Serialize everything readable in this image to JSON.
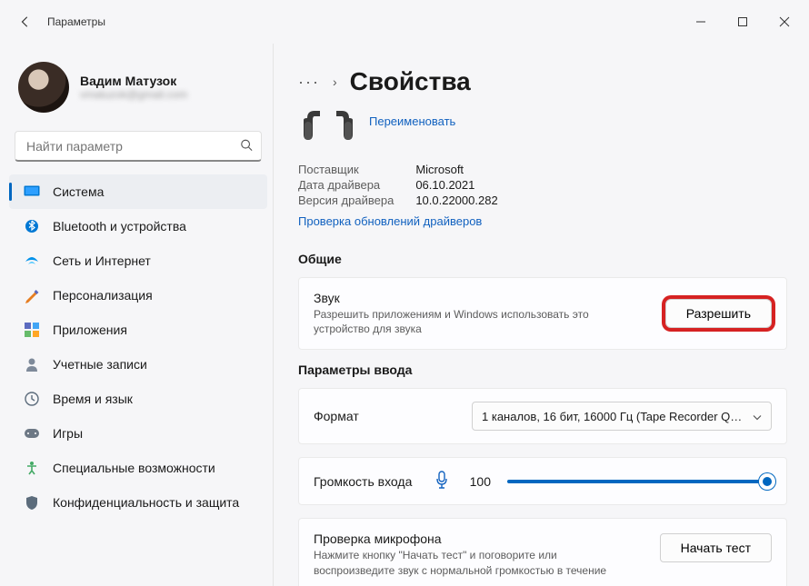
{
  "window": {
    "title": "Параметры"
  },
  "user": {
    "name": "Вадим Матузок",
    "email": "vmatuzok@gmail.com"
  },
  "search": {
    "placeholder": "Найти параметр"
  },
  "sidebar": {
    "items": [
      {
        "label": "Система",
        "active": true
      },
      {
        "label": "Bluetooth и устройства"
      },
      {
        "label": "Сеть и Интернет"
      },
      {
        "label": "Персонализация"
      },
      {
        "label": "Приложения"
      },
      {
        "label": "Учетные записи"
      },
      {
        "label": "Время и язык"
      },
      {
        "label": "Игры"
      },
      {
        "label": "Специальные возможности"
      },
      {
        "label": "Конфиденциальность и защита"
      }
    ]
  },
  "breadcrumb": {
    "title": "Свойства"
  },
  "device": {
    "rename_link": "Переименовать",
    "meta": {
      "supplier_label": "Поставщик",
      "supplier_value": "Microsoft",
      "driver_date_label": "Дата драйвера",
      "driver_date_value": "06.10.2021",
      "driver_version_label": "Версия драйвера",
      "driver_version_value": "10.0.22000.282"
    },
    "check_updates_link": "Проверка обновлений драйверов"
  },
  "sections": {
    "general": "Общие",
    "input_params": "Параметры ввода"
  },
  "sound_card": {
    "title": "Звук",
    "subtitle": "Разрешить приложениям и Windows использовать это устройство для звука",
    "button": "Разрешить"
  },
  "format": {
    "label": "Формат",
    "value": "1 каналов, 16 бит, 16000 Гц (Tape Recorder Q…"
  },
  "volume": {
    "label": "Громкость входа",
    "value": "100"
  },
  "mic_test": {
    "title": "Проверка микрофона",
    "subtitle": "Нажмите кнопку \"Начать тест\" и поговорите или воспроизведите звук с нормальной громкостью в течение",
    "button": "Начать тест"
  }
}
